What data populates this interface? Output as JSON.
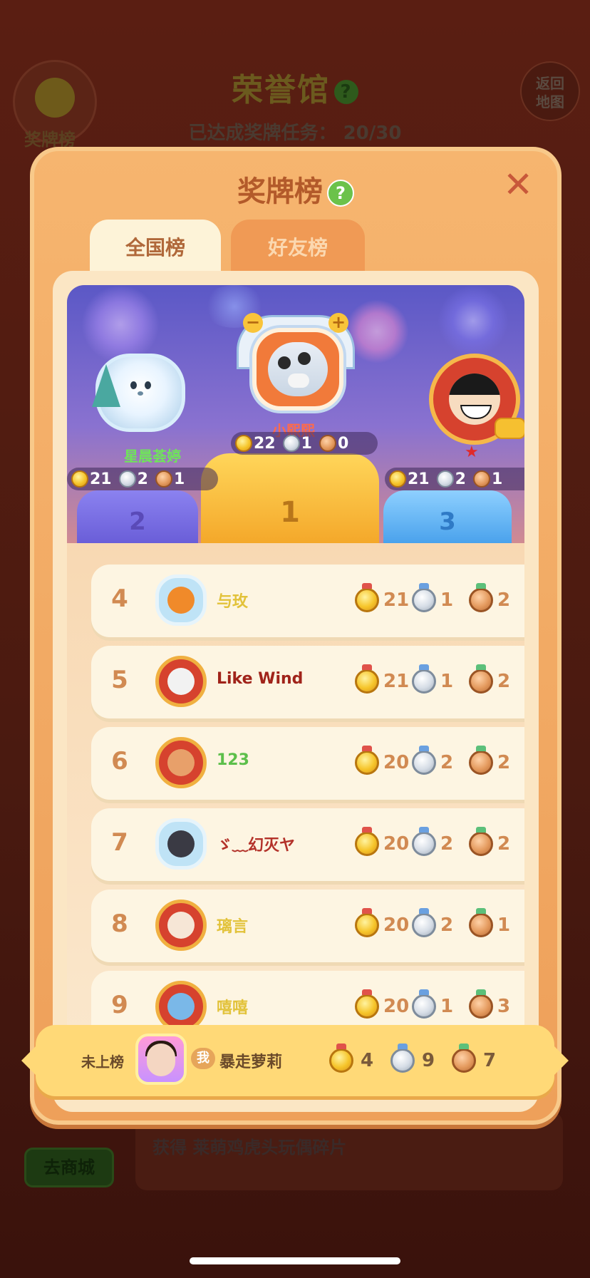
{
  "background": {
    "title": "荣誉馆",
    "progress_text": "已达成奖牌任务： 20/30",
    "medal_button_label": "奖牌榜",
    "return_button_label": "返回\n地图",
    "shop_button_label": "去商城",
    "reward_text": "获得 莱萌鸡虎头玩偶碎片"
  },
  "modal": {
    "title": "奖牌榜",
    "help_icon": "?",
    "close_icon": "✕",
    "tabs": [
      {
        "label": "全国榜",
        "active": true
      },
      {
        "label": "好友榜",
        "active": false
      }
    ]
  },
  "podium": {
    "first": {
      "rank": "1",
      "name": "小熙熙",
      "gold": "22",
      "silver": "1",
      "bronze": "0"
    },
    "second": {
      "rank": "2",
      "name": "星晨荟婷",
      "gold": "21",
      "silver": "2",
      "bronze": "1"
    },
    "third": {
      "rank": "3",
      "name": "",
      "gold": "21",
      "silver": "2",
      "bronze": "1"
    }
  },
  "rows": [
    {
      "rank": "4",
      "name": "与玫",
      "name_color": "#e2c23a",
      "gold": "21",
      "silver": "1",
      "bronze": "2"
    },
    {
      "rank": "5",
      "name": "Like  Wind",
      "name_color": "#a0231a",
      "gold": "21",
      "silver": "1",
      "bronze": "2"
    },
    {
      "rank": "6",
      "name": "123",
      "name_color": "#5cbf4a",
      "gold": "20",
      "silver": "2",
      "bronze": "2"
    },
    {
      "rank": "7",
      "name": "ゞ﹏幻灭ヤ",
      "name_color": "#b3322a",
      "gold": "20",
      "silver": "2",
      "bronze": "2"
    },
    {
      "rank": "8",
      "name": "璃言",
      "name_color": "#e2c23a",
      "gold": "20",
      "silver": "2",
      "bronze": "1"
    },
    {
      "rank": "9",
      "name": "嘻嘻",
      "name_color": "#e2c23a",
      "gold": "20",
      "silver": "1",
      "bronze": "3"
    }
  ],
  "self": {
    "status": "未上榜",
    "me_badge": "我",
    "name": "暴走萝莉",
    "gold": "4",
    "silver": "9",
    "bronze": "7"
  },
  "icons": {
    "gold_medal": "gold-medal-icon",
    "silver_medal": "silver-medal-icon",
    "bronze_medal": "bronze-medal-icon"
  }
}
